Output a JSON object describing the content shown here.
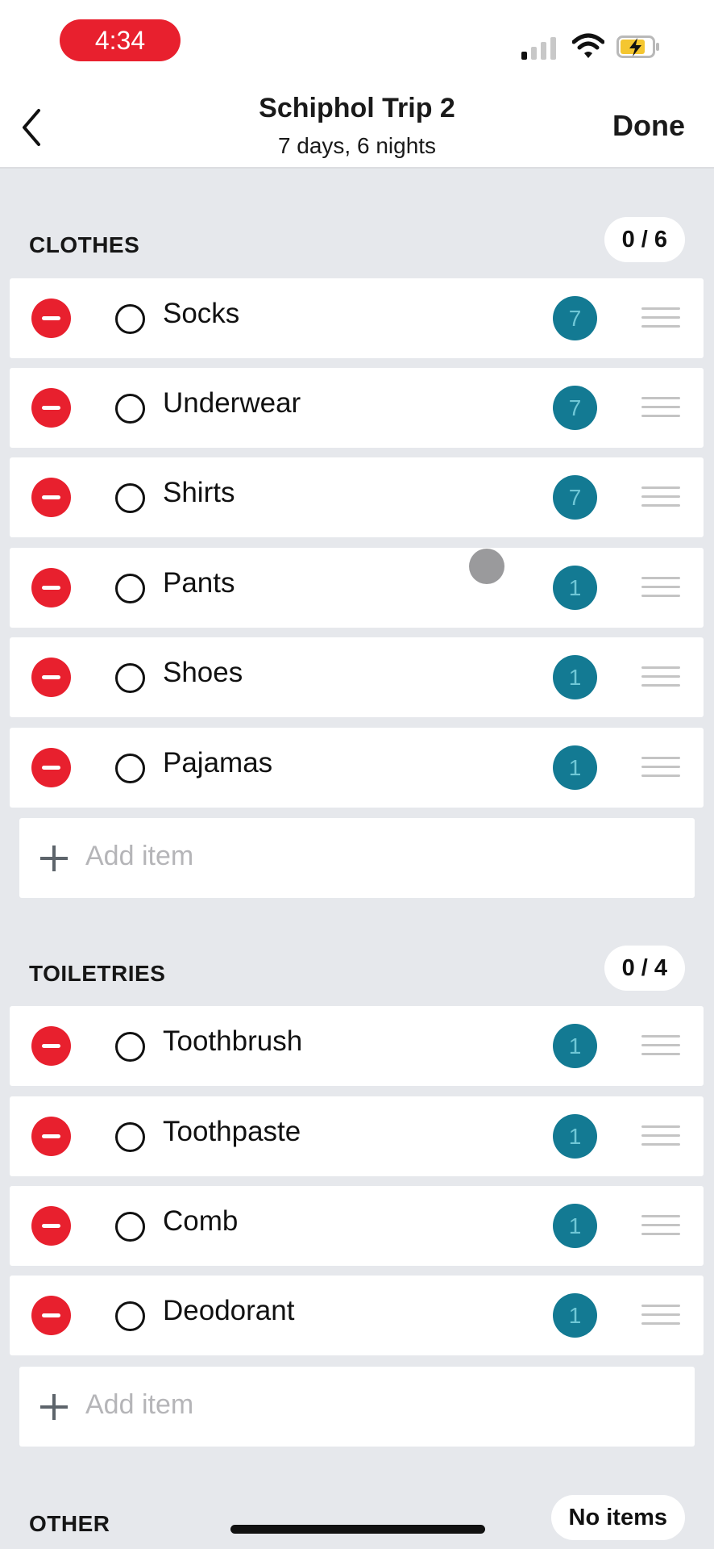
{
  "status_bar": {
    "time": "4:34",
    "signal_icon": "cellular-signal-icon",
    "wifi_icon": "wifi-icon",
    "battery_icon": "battery-charging-icon"
  },
  "header": {
    "title": "Schiphol Trip 2",
    "subtitle": "7 days, 6 nights",
    "back_icon": "chevron-left-icon",
    "done_label": "Done"
  },
  "colors": {
    "accent_red": "#e8202e",
    "badge_teal": "#137a93",
    "background": "#e6e8ec"
  },
  "sections": [
    {
      "name": "CLOTHES",
      "count": "0 / 6",
      "items": [
        {
          "label": "Socks",
          "qty": "7"
        },
        {
          "label": "Underwear",
          "qty": "7"
        },
        {
          "label": "Shirts",
          "qty": "7"
        },
        {
          "label": "Pants",
          "qty": "1"
        },
        {
          "label": "Shoes",
          "qty": "1"
        },
        {
          "label": "Pajamas",
          "qty": "1"
        }
      ],
      "add_placeholder": "Add item"
    },
    {
      "name": "TOILETRIES",
      "count": "0 / 4",
      "items": [
        {
          "label": "Toothbrush",
          "qty": "1"
        },
        {
          "label": "Toothpaste",
          "qty": "1"
        },
        {
          "label": "Comb",
          "qty": "1"
        },
        {
          "label": "Deodorant",
          "qty": "1"
        }
      ],
      "add_placeholder": "Add item"
    },
    {
      "name": "OTHER",
      "count": "No items",
      "items": []
    }
  ]
}
